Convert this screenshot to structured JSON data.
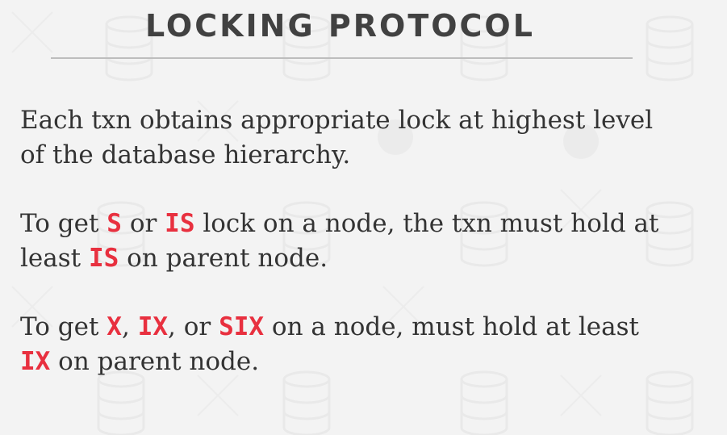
{
  "title": "LOCKING PROTOCOL",
  "paragraphs": {
    "p1": {
      "line1": "Each txn obtains appropriate lock at highest level",
      "line2": "of the database hierarchy."
    },
    "p2": {
      "t1": "To get ",
      "k1": "S",
      "t2": " or ",
      "k2": "IS",
      "t3": " lock on a node, the txn must hold at",
      "t4": "least ",
      "k3": "IS",
      "t5": " on parent node."
    },
    "p3": {
      "t1": "To get ",
      "k1": "X",
      "t2": ", ",
      "k2": "IX",
      "t3": ", or ",
      "k3": "SIX",
      "t4": " on a node, must hold at least",
      "k4": "IX",
      "t5": " on parent node."
    }
  },
  "colors": {
    "background": "#f3f3f3",
    "title": "#414141",
    "body_text": "#333333",
    "keyword": "#e8303f",
    "rule": "#bdbdbd"
  },
  "background_icons": [
    "database-icon",
    "skull-icon"
  ]
}
